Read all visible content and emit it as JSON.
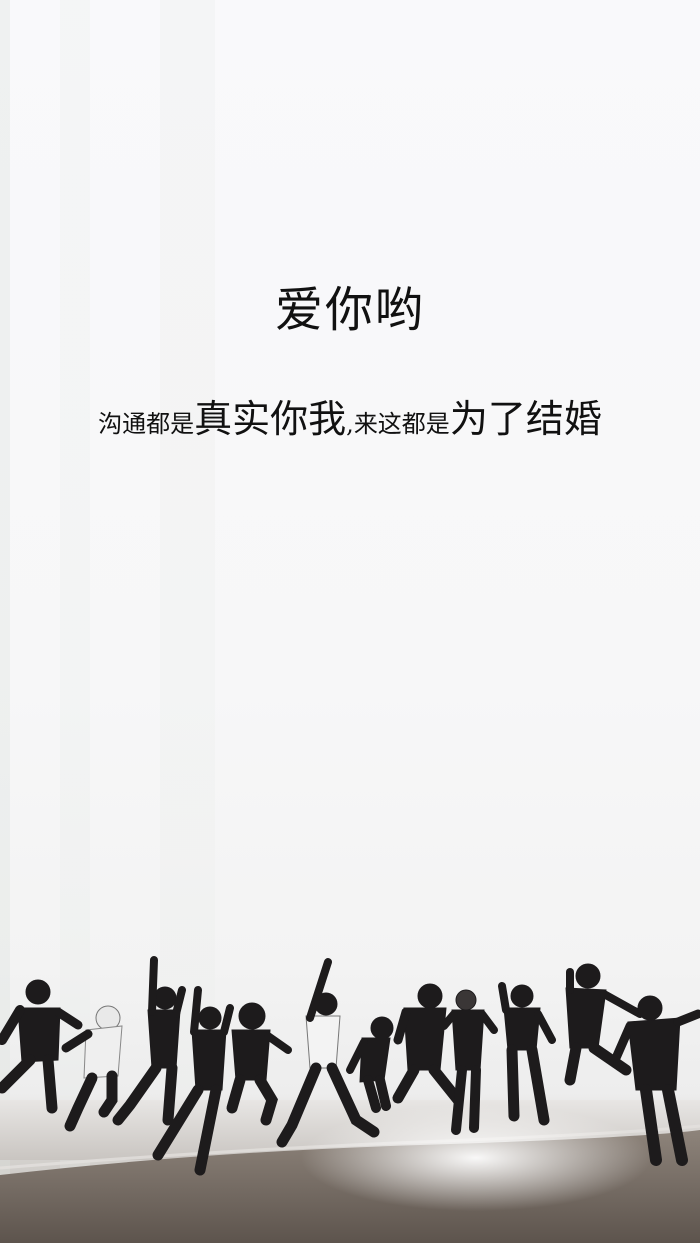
{
  "title": "爱你哟",
  "subtitle": {
    "p1": "沟通都是",
    "p2": "真实你我",
    "p3": ",",
    "p4": "来这都是",
    "p5": "为了结婚"
  },
  "scene": {
    "description_icon": "jumping-silhouettes-beach",
    "sea_color": "#d6d3d0",
    "sand_color": "#8a7f76",
    "silhouette_color": "#1d1b1c"
  }
}
